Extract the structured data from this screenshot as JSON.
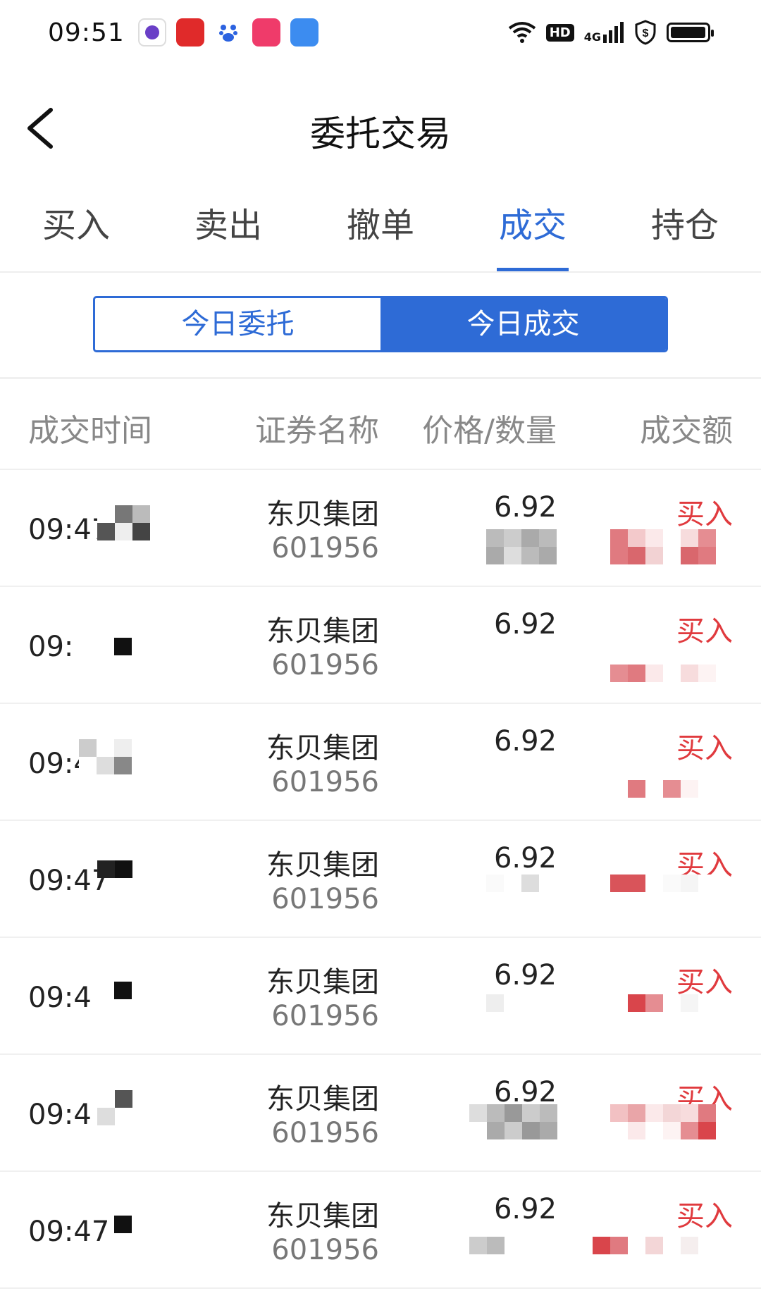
{
  "status_bar": {
    "time": "09:51",
    "app_icons": [
      {
        "name": "purple-app-icon",
        "color": "#6a3fc7"
      },
      {
        "name": "red-app-icon",
        "color": "#e02a2a"
      },
      {
        "name": "baidu-icon",
        "color": "#2b62e0"
      },
      {
        "name": "shopping-app-icon",
        "color": "#ef3b6a"
      },
      {
        "name": "blue-app-icon",
        "color": "#3c8cf0"
      }
    ],
    "hd_label": "HD",
    "network_label": "4G"
  },
  "header": {
    "title": "委托交易"
  },
  "tabs": [
    {
      "label": "买入",
      "active": false
    },
    {
      "label": "卖出",
      "active": false
    },
    {
      "label": "撤单",
      "active": false
    },
    {
      "label": "成交",
      "active": true
    },
    {
      "label": "持仓",
      "active": false
    }
  ],
  "segment": {
    "items": [
      {
        "label": "今日委托",
        "active": false
      },
      {
        "label": "今日成交",
        "active": true
      }
    ]
  },
  "columns": {
    "time": "成交时间",
    "name": "证券名称",
    "price_qty": "价格/数量",
    "amount": "成交额"
  },
  "rows": [
    {
      "time": "09:47",
      "name": "东贝集团",
      "code": "601956",
      "price": "6.92",
      "side": "买入"
    },
    {
      "time": "09:",
      "name": "东贝集团",
      "code": "601956",
      "price": "6.92",
      "side": "买入"
    },
    {
      "time": "09:4",
      "name": "东贝集团",
      "code": "601956",
      "price": "6.92",
      "side": "买入"
    },
    {
      "time": "09:47",
      "name": "东贝集团",
      "code": "601956",
      "price": "6.92",
      "side": "买入"
    },
    {
      "time": "09:4",
      "name": "东贝集团",
      "code": "601956",
      "price": "6.92",
      "side": "买入"
    },
    {
      "time": "09:4",
      "name": "东贝集团",
      "code": "601956",
      "price": "6.92",
      "side": "买入"
    },
    {
      "time": "09:47",
      "name": "东贝集团",
      "code": "601956",
      "price": "6.92",
      "side": "买入"
    }
  ],
  "colors": {
    "accent": "#2e6bd6",
    "buy": "#e03a3e"
  }
}
